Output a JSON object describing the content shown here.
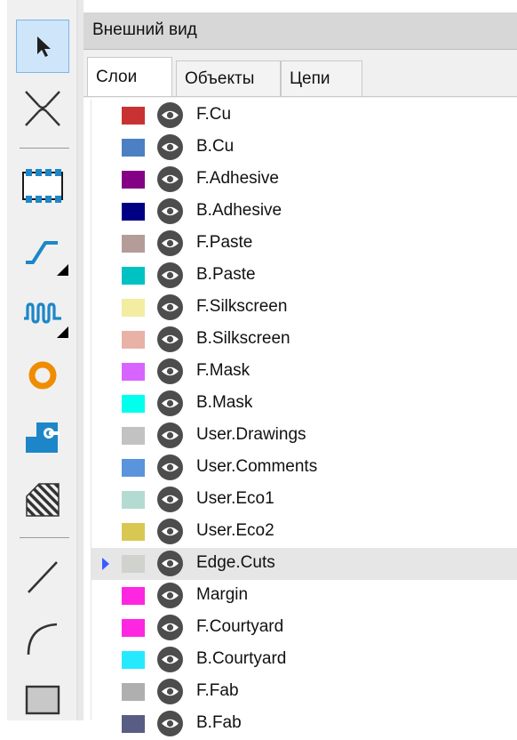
{
  "panel": {
    "title": "Внешний вид",
    "tabs": [
      {
        "label": "Слои",
        "active": true
      },
      {
        "label": "Объекты",
        "active": false
      },
      {
        "label": "Цепи",
        "active": false
      }
    ]
  },
  "toolbar": {
    "tools": [
      {
        "name": "select-tool",
        "icon": "cursor-arrow-icon",
        "active": true
      },
      {
        "name": "local-ratsnest-tool",
        "icon": "ratsnest-cross-icon",
        "active": false
      },
      {
        "name": "footprint-tool",
        "icon": "footprint-chip-icon",
        "active": false
      },
      {
        "name": "route-track-tool",
        "icon": "route-track-icon",
        "active": false,
        "has_submenu": true
      },
      {
        "name": "tune-length-tool",
        "icon": "meander-icon",
        "active": false,
        "has_submenu": true
      },
      {
        "name": "via-tool",
        "icon": "via-ring-icon",
        "active": false
      },
      {
        "name": "zone-tool",
        "icon": "filled-zone-icon",
        "active": false
      },
      {
        "name": "rule-area-tool",
        "icon": "hatched-area-icon",
        "active": false
      },
      {
        "name": "line-tool",
        "icon": "draw-line-icon",
        "active": false
      },
      {
        "name": "arc-tool",
        "icon": "draw-arc-icon",
        "active": false
      },
      {
        "name": "rectangle-tool",
        "icon": "draw-rectangle-icon",
        "active": false
      }
    ]
  },
  "layers": [
    {
      "name": "F.Cu",
      "color": "#c83232",
      "selected": false
    },
    {
      "name": "B.Cu",
      "color": "#4d7fc4",
      "selected": false
    },
    {
      "name": "F.Adhesive",
      "color": "#840084",
      "selected": false
    },
    {
      "name": "B.Adhesive",
      "color": "#000084",
      "selected": false
    },
    {
      "name": "F.Paste",
      "color": "#b49c98",
      "selected": false
    },
    {
      "name": "B.Paste",
      "color": "#00c2c2",
      "selected": false
    },
    {
      "name": "F.Silkscreen",
      "color": "#f2eda1",
      "selected": false
    },
    {
      "name": "B.Silkscreen",
      "color": "#e8b2a7",
      "selected": false
    },
    {
      "name": "F.Mask",
      "color": "#d864ff",
      "selected": false
    },
    {
      "name": "B.Mask",
      "color": "#02ffee",
      "selected": false
    },
    {
      "name": "User.Drawings",
      "color": "#c2c2c2",
      "selected": false
    },
    {
      "name": "User.Comments",
      "color": "#5994dc",
      "selected": false
    },
    {
      "name": "User.Eco1",
      "color": "#b4dbd2",
      "selected": false
    },
    {
      "name": "User.Eco2",
      "color": "#d8c852",
      "selected": false
    },
    {
      "name": "Edge.Cuts",
      "color": "#d0d2cd",
      "selected": true
    },
    {
      "name": "Margin",
      "color": "#ff26e2",
      "selected": false
    },
    {
      "name": "F.Courtyard",
      "color": "#ff26e2",
      "selected": false
    },
    {
      "name": "B.Courtyard",
      "color": "#26e9ff",
      "selected": false
    },
    {
      "name": "F.Fab",
      "color": "#afafaf",
      "selected": false
    },
    {
      "name": "B.Fab",
      "color": "#585d84",
      "selected": false
    }
  ]
}
